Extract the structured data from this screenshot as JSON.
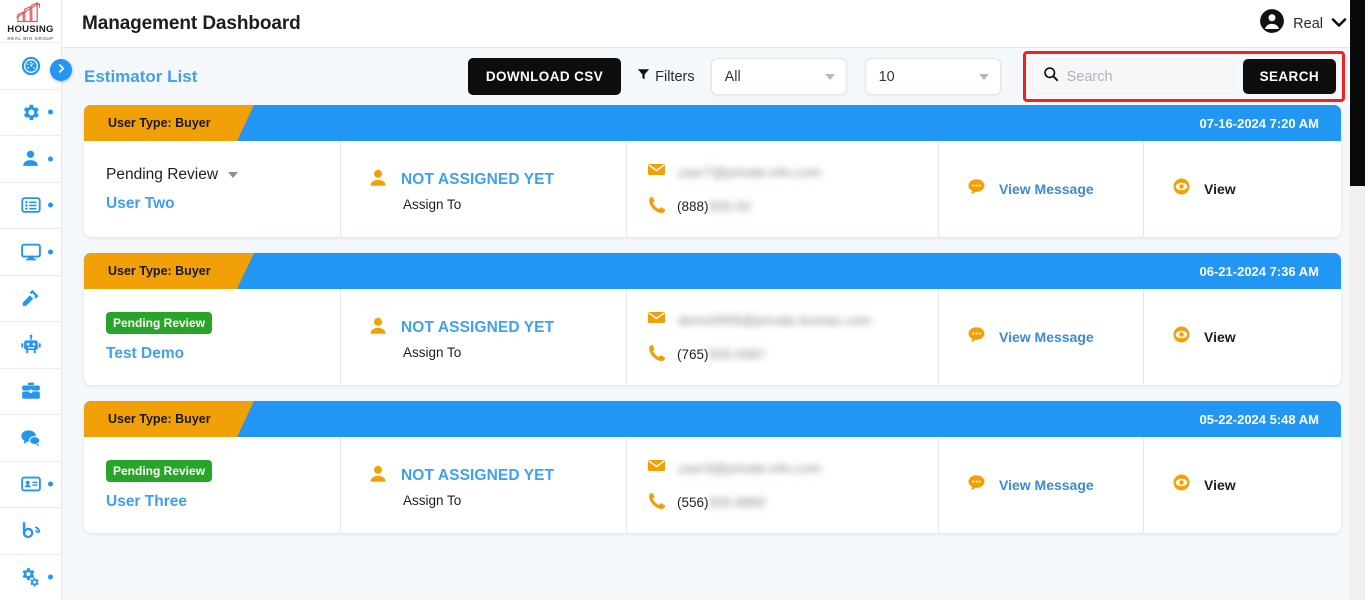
{
  "brand": {
    "name": "HOUSING",
    "tagline": "REAL BIO GROUP",
    "logo_icon": "building-chart-icon",
    "accent_blue": "#2196f3",
    "accent_orange": "#f2a007",
    "accent_green": "#28a428",
    "highlight_red": "#f32020"
  },
  "sidebar": {
    "toggle_icon": "chevron-right-icon",
    "items": [
      {
        "icon": "dashboard-speedometer-icon",
        "dot": false
      },
      {
        "icon": "gear-settings-icon",
        "dot": true
      },
      {
        "icon": "person-user-icon",
        "dot": true
      },
      {
        "icon": "list-items-icon",
        "dot": true
      },
      {
        "icon": "monitor-desktop-icon",
        "dot": true
      },
      {
        "icon": "hammer-tools-icon",
        "dot": false
      },
      {
        "icon": "robot-icon",
        "dot": false
      },
      {
        "icon": "briefcase-toolbox-icon",
        "dot": false
      },
      {
        "icon": "chat-bubbles-icon",
        "dot": false
      },
      {
        "icon": "id-card-icon",
        "dot": true
      },
      {
        "icon": "blog-rss-icon",
        "dot": false
      },
      {
        "icon": "gears-config-icon",
        "dot": true
      }
    ]
  },
  "header": {
    "title": "Management Dashboard",
    "account_icon": "account-circle-icon",
    "account_name": "Real",
    "account_caret_icon": "chevron-down-icon"
  },
  "toolbar": {
    "section_title": "Estimator List",
    "download_label": "DOWNLOAD CSV",
    "filters_label": "Filters",
    "filters_icon": "funnel-filter-icon",
    "type_select_value": "All",
    "count_select_value": "10",
    "search_icon": "search-magnifier-icon",
    "search_placeholder": "Search",
    "search_value": "",
    "search_button_label": "SEARCH"
  },
  "cards": [
    {
      "user_type_label": "User Type: Buyer",
      "date": "07-16-2024 7:20 AM",
      "status_label": "Pending Review",
      "status_style": "plain",
      "person_name": "User Two",
      "assign_label": "NOT ASSIGNED YET",
      "assign_sub": "Assign To",
      "assign_icon": "person-user-icon",
      "email_icon": "envelope-mail-icon",
      "email_value": "user7@private.info.com",
      "email_redacted": true,
      "phone_icon": "phone-handset-icon",
      "phone_prefix": "(888)",
      "phone_rest": "555-00",
      "phone_redacted": true,
      "message_icon": "chat-bubble-icon",
      "message_label": "View Message",
      "view_icon": "eye-view-icon",
      "view_label": "View"
    },
    {
      "user_type_label": "User Type: Buyer",
      "date": "06-21-2024 7:36 AM",
      "status_label": "Pending Review",
      "status_style": "badge",
      "person_name": "Test Demo",
      "assign_label": "NOT ASSIGNED YET",
      "assign_sub": "Assign To",
      "assign_icon": "person-user-icon",
      "email_icon": "envelope-mail-icon",
      "email_value": "demo9908@private.bureau.com",
      "email_redacted": true,
      "phone_icon": "phone-handset-icon",
      "phone_prefix": "(765)",
      "phone_rest": "555-0087",
      "phone_redacted": true,
      "message_icon": "chat-bubble-icon",
      "message_label": "View Message",
      "view_icon": "eye-view-icon",
      "view_label": "View"
    },
    {
      "user_type_label": "User Type: Buyer",
      "date": "05-22-2024 5:48 AM",
      "status_label": "Pending Review",
      "status_style": "badge",
      "person_name": "User Three",
      "assign_label": "NOT ASSIGNED YET",
      "assign_sub": "Assign To",
      "assign_icon": "person-user-icon",
      "email_icon": "envelope-mail-icon",
      "email_value": "user3@private.info.com",
      "email_redacted": true,
      "phone_icon": "phone-handset-icon",
      "phone_prefix": "(556)",
      "phone_rest": "555-8880",
      "phone_redacted": true,
      "message_icon": "chat-bubble-icon",
      "message_label": "View Message",
      "view_icon": "eye-view-icon",
      "view_label": "View"
    }
  ],
  "scrollbar": {
    "icon": "vertical-scrollbar"
  }
}
